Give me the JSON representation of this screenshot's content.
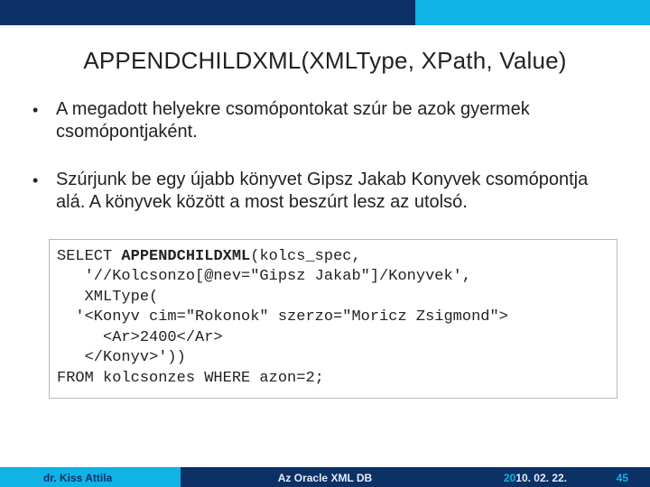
{
  "title": "APPENDCHILDXML(XMLType, XPath, Value)",
  "bullets": [
    "A megadott helyekre csomópontokat szúr be azok gyermek csomópontjaként.",
    "Szúrjunk be egy újabb könyvet Gipsz Jakab Konyvek csomópontja alá. A könyvek között a most beszúrt lesz az utolsó."
  ],
  "code": {
    "l1a": "SELECT ",
    "l1b": "APPENDCHILDXML",
    "l1c": "(kolcs_spec,",
    "l2": "   '//Kolcsonzo[@nev=\"Gipsz Jakab\"]/Konyvek',",
    "l3": "   XMLType(",
    "l4": "  '<Konyv cim=\"Rokonok\" szerzo=\"Moricz Zsigmond\">",
    "l5": "     <Ar>2400</Ar>",
    "l6": "   </Konyv>'))",
    "l7": "FROM kolcsonzes WHERE azon=2;"
  },
  "footer": {
    "author": "dr. Kiss Attila",
    "center": "Az Oracle XML DB",
    "date_prefix": "20",
    "date_rest": "10. 02. 22.",
    "page": "45"
  }
}
